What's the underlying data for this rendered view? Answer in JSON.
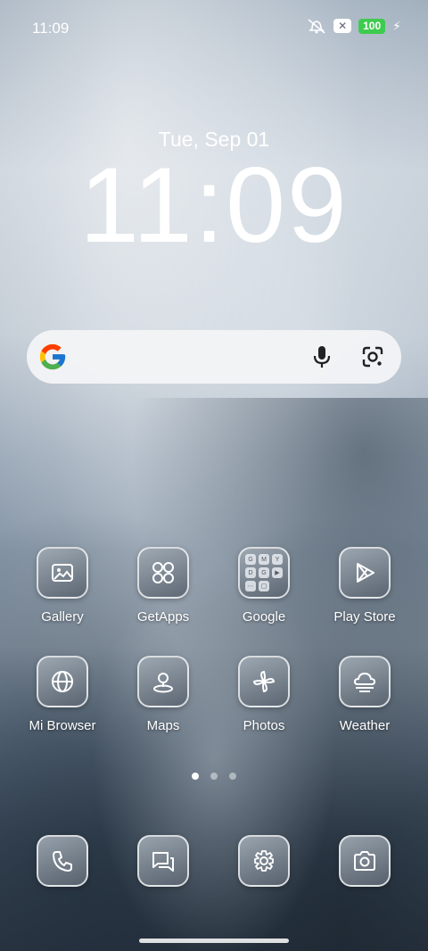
{
  "status_bar": {
    "time": "11:09",
    "notification_badge": "✕",
    "battery": "100",
    "icons": [
      "ringer-off-icon",
      "x-notification-icon",
      "battery-icon",
      "charging-icon"
    ]
  },
  "lockclock": {
    "date": "Tue, Sep 01",
    "time": "11:09"
  },
  "search": {
    "icons": [
      "google-g-icon",
      "microphone-icon",
      "lens-camera-icon"
    ]
  },
  "apps_row1": [
    {
      "label": "Gallery",
      "icon": "gallery-icon"
    },
    {
      "label": "GetApps",
      "icon": "four-circles-icon"
    },
    {
      "label": "Google",
      "icon": "folder-icon"
    },
    {
      "label": "Play Store",
      "icon": "play-triangle-icon"
    }
  ],
  "apps_row2": [
    {
      "label": "Mi Browser",
      "icon": "globe-icon"
    },
    {
      "label": "Maps",
      "icon": "map-pin-icon"
    },
    {
      "label": "Photos",
      "icon": "pinwheel-icon"
    },
    {
      "label": "Weather",
      "icon": "cloud-sun-icon"
    }
  ],
  "dock": [
    {
      "icon": "phone-icon"
    },
    {
      "icon": "messages-icon"
    },
    {
      "icon": "settings-gear-icon"
    },
    {
      "icon": "camera-icon"
    }
  ],
  "folder_minis": [
    "G",
    "M",
    "Y",
    "D",
    "G",
    "▶",
    "⋯",
    "▢"
  ],
  "page_indicator": {
    "count": 3,
    "active": 1
  },
  "colors": {
    "battery": "#3ecb4f",
    "search_bg": "#f2f4f6"
  }
}
